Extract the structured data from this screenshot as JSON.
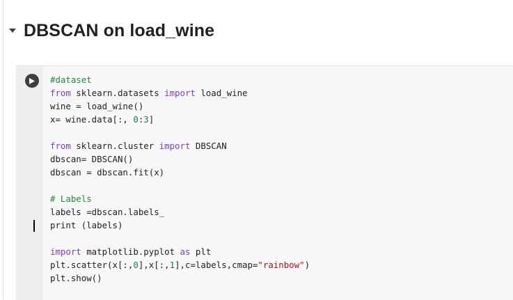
{
  "section": {
    "title": "DBSCAN on load_wine",
    "collapse_icon": "caret-down-icon"
  },
  "cell": {
    "run_icon": "play-circle-icon",
    "lines": [
      [
        {
          "t": "#dataset",
          "c": "cm"
        }
      ],
      [
        {
          "t": "from",
          "c": "kw"
        },
        {
          "t": " sklearn.datasets "
        },
        {
          "t": "import",
          "c": "kw"
        },
        {
          "t": " load_wine"
        }
      ],
      [
        {
          "t": "wine = load_wine()"
        }
      ],
      [
        {
          "t": "x= wine.data[:, "
        },
        {
          "t": "0",
          "c": "nm"
        },
        {
          "t": ":"
        },
        {
          "t": "3",
          "c": "nm"
        },
        {
          "t": "]"
        }
      ],
      [],
      [
        {
          "t": "from",
          "c": "kw"
        },
        {
          "t": " sklearn.cluster "
        },
        {
          "t": "import",
          "c": "kw"
        },
        {
          "t": " DBSCAN"
        }
      ],
      [
        {
          "t": "dbscan= DBSCAN()"
        }
      ],
      [
        {
          "t": "dbscan = dbscan.fit(x)"
        }
      ],
      [],
      [
        {
          "t": "# Labels",
          "c": "cm"
        }
      ],
      [
        {
          "t": "labels =dbscan.labels_"
        }
      ],
      [
        {
          "t": "print (labels)"
        }
      ],
      [],
      [
        {
          "t": "import",
          "c": "kw"
        },
        {
          "t": " matplotlib.pyplot "
        },
        {
          "t": "as",
          "c": "kw"
        },
        {
          "t": " plt"
        }
      ],
      [
        {
          "t": "plt.scatter(x[:,"
        },
        {
          "t": "0",
          "c": "nm"
        },
        {
          "t": "],x[:,"
        },
        {
          "t": "1",
          "c": "nm"
        },
        {
          "t": "],c=labels,cmap="
        },
        {
          "t": "\"rainbow\"",
          "c": "st"
        },
        {
          "t": ")"
        }
      ],
      [
        {
          "t": "plt.show()"
        }
      ],
      []
    ]
  },
  "colors": {
    "keyword": "#7d3cc8",
    "comment": "#1e8a3e",
    "number": "#1a7f4b",
    "string": "#a31515"
  }
}
